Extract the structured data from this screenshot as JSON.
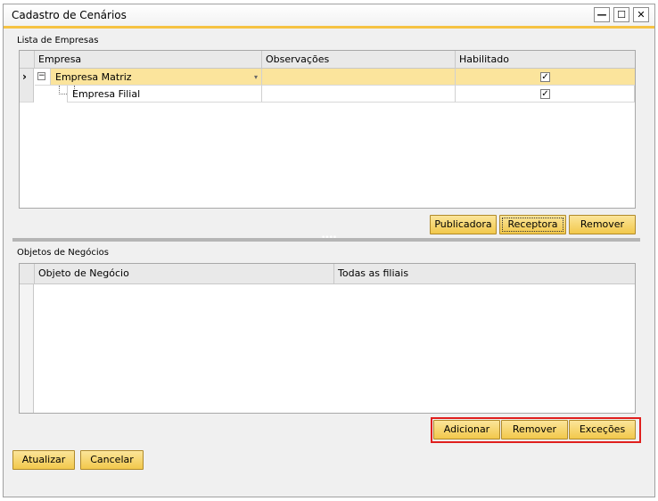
{
  "window": {
    "title": "Cadastro de Cenários",
    "controls": {
      "minimize": "—",
      "maximize": "☐",
      "close": "✕"
    }
  },
  "empresas_section": {
    "label": "Lista de Empresas",
    "columns": [
      "Empresa",
      "Observações",
      "Habilitado"
    ],
    "rows": [
      {
        "expander": "⊟",
        "empresa": "Empresa Matriz",
        "observacoes": "",
        "habilitado": true,
        "selected": true
      },
      {
        "expander": "",
        "empresa": "Empresa Filial",
        "observacoes": "",
        "habilitado": true,
        "selected": false
      }
    ],
    "buttons": {
      "publicadora": "Publicadora",
      "receptora": "Receptora",
      "remover": "Remover"
    }
  },
  "objetos_section": {
    "label": "Objetos de Negócios",
    "columns": [
      "Objeto de Negócio",
      "Todas as filiais"
    ],
    "rows": [],
    "buttons": {
      "adicionar": "Adicionar",
      "remover": "Remover",
      "excecoes": "Exceções"
    }
  },
  "footer": {
    "atualizar": "Atualizar",
    "cancelar": "Cancelar"
  },
  "colors": {
    "accent": "#f6c343",
    "selected_row": "#fbe49c",
    "highlight_border": "#e0201e"
  }
}
